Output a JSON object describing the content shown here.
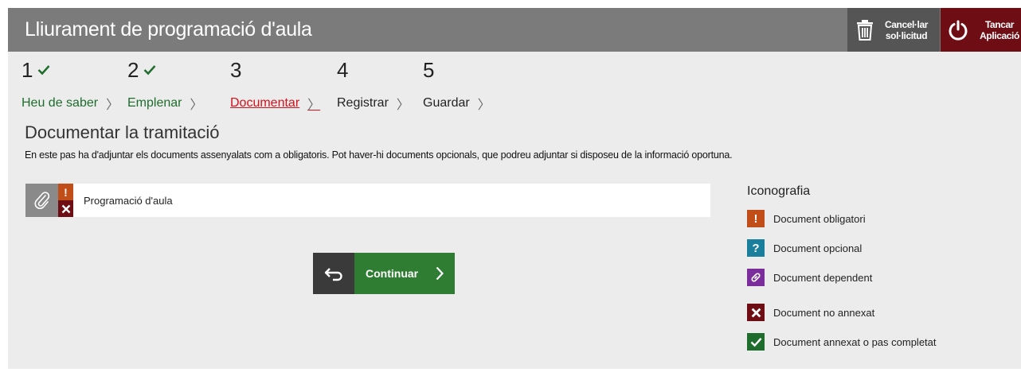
{
  "header": {
    "title": "Lliurament de programació d'aula",
    "cancel_label_1": "Cancel·lar",
    "cancel_label_2": "sol·licitud",
    "close_label_1": "Tancar",
    "close_label_2": "Aplicació"
  },
  "steps": [
    {
      "number": "1",
      "name": "Heu de saber",
      "status": "done"
    },
    {
      "number": "2",
      "name": "Emplenar",
      "status": "done"
    },
    {
      "number": "3",
      "name": "Documentar",
      "status": "current"
    },
    {
      "number": "4",
      "name": "Registrar",
      "status": "pending"
    },
    {
      "number": "5",
      "name": "Guardar",
      "status": "pending"
    }
  ],
  "section": {
    "title": "Documentar la tramitació",
    "description": "En este pas ha d'adjuntar els documents assenyalats com a obligatoris. Pot haver-hi documents opcionals, que podreu adjuntar si disposeu de la informació oportuna."
  },
  "document": {
    "label": "Programació d'aula",
    "required_icon": "exclamation-icon",
    "status_icon": "cross-icon"
  },
  "actions": {
    "continue_label": "Continuar"
  },
  "legend": {
    "title": "Iconografia",
    "items": [
      {
        "label": "Document obligatori",
        "icon": "!",
        "color": "#c14d18"
      },
      {
        "label": "Document opcional",
        "icon": "?",
        "color": "#1a7f9c"
      },
      {
        "label": "Document dependent",
        "icon": "link",
        "color": "#7b2d9c"
      },
      {
        "label": "Document no annexat",
        "icon": "cross",
        "color": "#6e0d13"
      },
      {
        "label": "Document annexat o pas completat",
        "icon": "check",
        "color": "#1e6d2d"
      }
    ]
  }
}
